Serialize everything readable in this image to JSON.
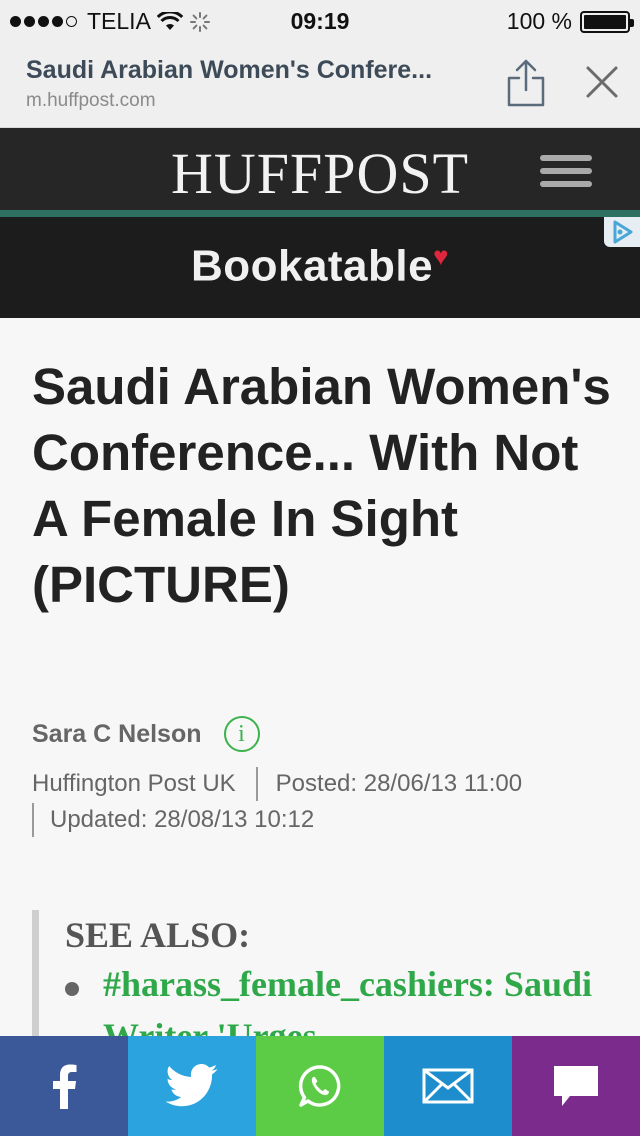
{
  "status_bar": {
    "carrier": "TELIA",
    "time": "09:19",
    "battery_percent": "100 %",
    "battery_level": 1.0
  },
  "browser": {
    "page_title": "Saudi Arabian Women's Confere...",
    "url": "m.huffpost.com",
    "share_icon": "share-icon",
    "close_icon": "close-icon"
  },
  "site_header": {
    "logo": "HUFFPOST",
    "menu_icon": "hamburger-menu-icon",
    "accent_color": "#2e7062"
  },
  "ad": {
    "brand": "Bookatable",
    "heart": "♥",
    "adchoices_icon": "adchoices-icon"
  },
  "article": {
    "headline": "Saudi Arabian Women's Conference... With Not A Female In Sight (PICTURE)",
    "author": "Sara C Nelson",
    "info_icon_text": "i",
    "publication": "Huffington Post UK",
    "posted": "Posted: 28/06/13 11:00",
    "updated": "Updated: 28/08/13 10:12",
    "see_also": {
      "title": "SEE ALSO:",
      "items": [
        {
          "label": "#harass_female_cashiers: Saudi Writer 'Urges"
        }
      ]
    }
  },
  "share_bar": {
    "items": [
      {
        "name": "facebook",
        "icon": "facebook-icon",
        "color": "#3b5998"
      },
      {
        "name": "twitter",
        "icon": "twitter-icon",
        "color": "#2aa3df"
      },
      {
        "name": "whatsapp",
        "icon": "whatsapp-icon",
        "color": "#5ccb45"
      },
      {
        "name": "email",
        "icon": "email-icon",
        "color": "#1d8dcd"
      },
      {
        "name": "comment",
        "icon": "comment-icon",
        "color": "#7b2b8c"
      }
    ]
  }
}
